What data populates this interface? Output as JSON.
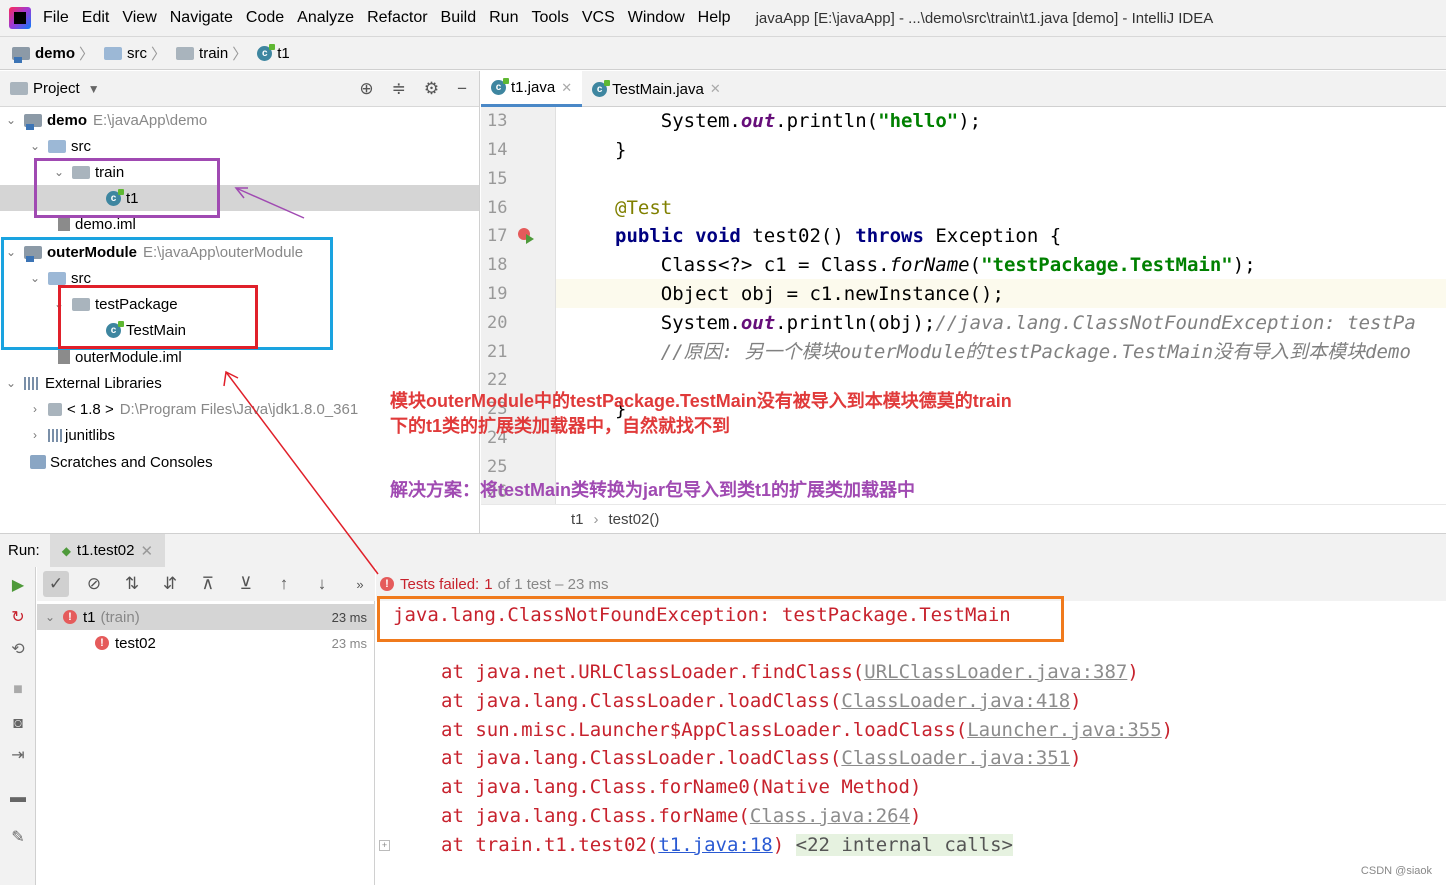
{
  "menubar": {
    "items": [
      "File",
      "Edit",
      "View",
      "Navigate",
      "Code",
      "Analyze",
      "Refactor",
      "Build",
      "Run",
      "Tools",
      "VCS",
      "Window",
      "Help"
    ],
    "title": "javaApp [E:\\javaApp] - ...\\demo\\src\\train\\t1.java [demo] - IntelliJ IDEA"
  },
  "navbar": {
    "crumbs": [
      "demo",
      "src",
      "train",
      "t1"
    ]
  },
  "project": {
    "header": "Project",
    "tree": [
      {
        "label": "demo",
        "path": "E:\\javaApp\\demo"
      },
      {
        "label": "src"
      },
      {
        "label": "train"
      },
      {
        "label": "t1"
      },
      {
        "label": "demo.iml"
      },
      {
        "label": "outerModule",
        "path": "E:\\javaApp\\outerModule"
      },
      {
        "label": "src"
      },
      {
        "label": "testPackage"
      },
      {
        "label": "TestMain"
      },
      {
        "label": "outerModule.iml"
      },
      {
        "label": "External Libraries"
      },
      {
        "label": "< 1.8 >",
        "path": "D:\\Program Files\\Java\\jdk1.8.0_361"
      },
      {
        "label": "junitlibs"
      },
      {
        "label": "Scratches and Consoles"
      }
    ]
  },
  "editor": {
    "tabs": [
      "t1.java",
      "TestMain.java"
    ],
    "line_numbers": [
      "13",
      "14",
      "15",
      "16",
      "17",
      "18",
      "19",
      "20",
      "21",
      "22",
      "23",
      "24",
      "25",
      "26"
    ],
    "code": {
      "l13_a": "    System.",
      "l13_b": "out",
      "l13_c": ".println(",
      "l13_d": "\"hello\"",
      "l13_e": ");",
      "l14": "}",
      "l16": "@Test",
      "l17_a": "public",
      "l17_b": " ",
      "l17_c": "void",
      "l17_d": " test02() ",
      "l17_e": "throws",
      "l17_f": " Exception {",
      "l18_a": "    Class<?> c1 = Class.",
      "l18_b": "forName",
      "l18_c": "(",
      "l18_d": "\"testPackage.TestMain\"",
      "l18_e": ");",
      "l19": "    Object obj = c1.newInstance();",
      "l20_a": "    System.",
      "l20_b": "out",
      "l20_c": ".println(obj);",
      "l20_d": "//java.lang.ClassNotFoundException: testPa",
      "l21": "    //原因: 另一个模块outerModule的testPackage.TestMain没有导入到本模块demo",
      "l23": "}"
    },
    "breadcrumb": [
      "t1",
      "test02()"
    ]
  },
  "run": {
    "label": "Run:",
    "tab": "t1.test02",
    "summary_prefix": "Tests failed:",
    "summary_count": "1",
    "summary_suffix": "of 1 test – 23 ms",
    "tree": [
      {
        "label": "t1",
        "sub": "(train)",
        "time": "23 ms"
      },
      {
        "label": "test02",
        "time": "23 ms"
      }
    ],
    "exception": "java.lang.ClassNotFoundException: testPackage.TestMain",
    "stack": [
      {
        "at": "at java.net.URLClassLoader.findClass(",
        "link": "URLClassLoader.java:387",
        "end": ")"
      },
      {
        "at": "at java.lang.ClassLoader.loadClass(",
        "link": "ClassLoader.java:418",
        "end": ")"
      },
      {
        "at": "at sun.misc.Launcher$AppClassLoader.loadClass(",
        "link": "Launcher.java:355",
        "end": ")"
      },
      {
        "at": "at java.lang.ClassLoader.loadClass(",
        "link": "ClassLoader.java:351",
        "end": ")"
      },
      {
        "at": "at java.lang.Class.forName0(Native Method)",
        "link": "",
        "end": ""
      },
      {
        "at": "at java.lang.Class.forName(",
        "link": "Class.java:264",
        "end": ")"
      },
      {
        "at": "at train.t1.test02(",
        "link": "t1.java:18",
        "end": ")",
        "internal": "<22 internal calls>"
      }
    ]
  },
  "annotations": {
    "note1_line1": "模块outerModule中的testPackage.TestMain没有被导入到本模块德莫的train",
    "note1_line2": "下的t1类的扩展类加载器中，自然就找不到",
    "note2": "解决方案：将testMain类转换为jar包导入到类t1的扩展类加载器中",
    "colors": {
      "purple_box": "#a04ab2",
      "blue_box": "#1aa3e0",
      "red_box": "#e0202a",
      "orange_box": "#f07a1c"
    }
  },
  "watermark": "CSDN @siaok"
}
